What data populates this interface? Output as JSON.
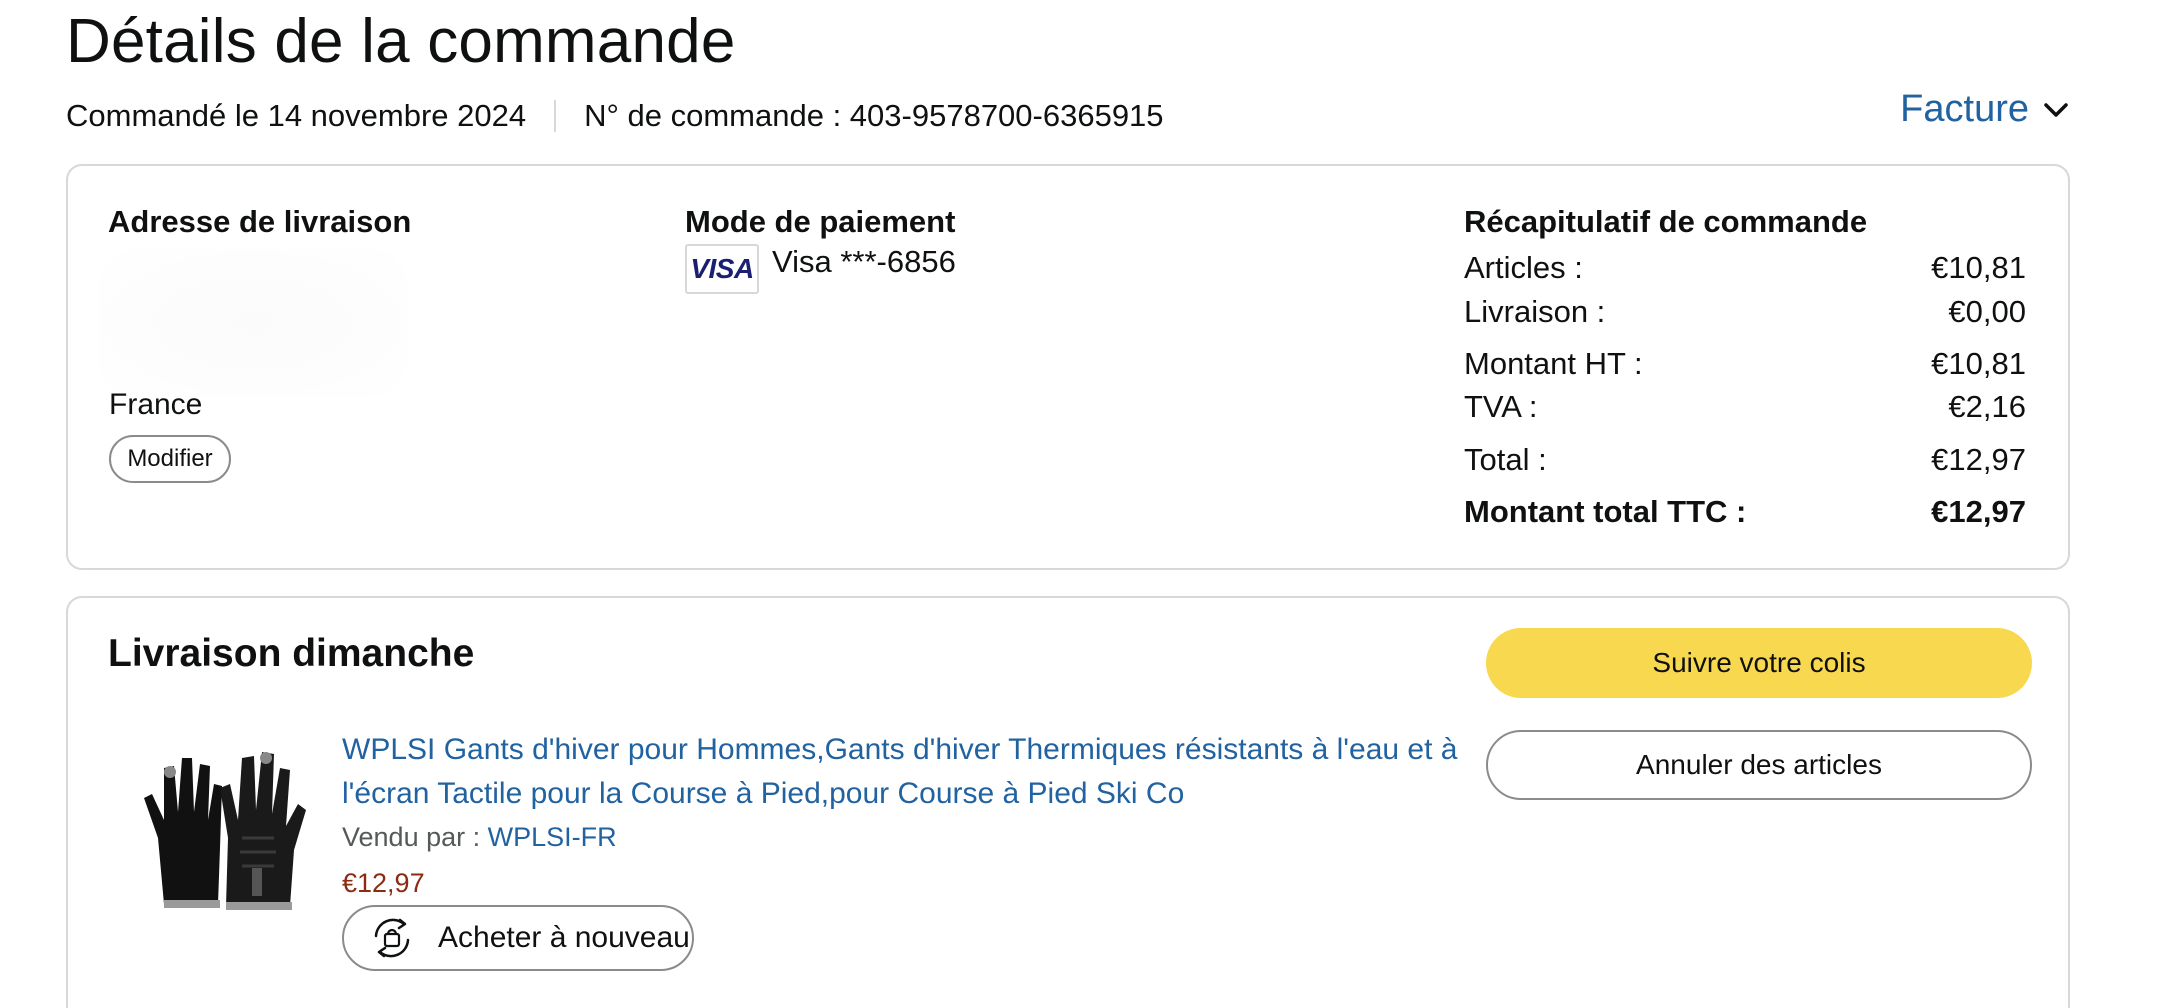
{
  "page": {
    "title": "Détails de la commande",
    "order_date": "Commandé le 14 novembre 2024",
    "order_number": "N° de commande : 403-9578700-6365915",
    "invoice_label": "Facture"
  },
  "summary_card": {
    "shipping_address": {
      "heading": "Adresse de livraison",
      "country": "France",
      "modify_label": "Modifier"
    },
    "payment": {
      "heading": "Mode de paiement",
      "card_brand": "VISA",
      "card_text": "Visa ***-6856"
    },
    "order_summary": {
      "heading": "Récapitulatif de commande",
      "rows": [
        {
          "label": "Articles :",
          "value": "€10,81"
        },
        {
          "label": "Livraison :",
          "value": "€0,00"
        },
        {
          "label": "Montant HT :",
          "value": "€10,81"
        },
        {
          "label": "TVA :",
          "value": "€2,16"
        },
        {
          "label": "Total :",
          "value": "€12,97"
        },
        {
          "label": "Montant total TTC :",
          "value": "€12,97"
        }
      ]
    }
  },
  "shipment": {
    "heading": "Livraison dimanche",
    "product": {
      "title": "WPLSI Gants d'hiver pour Hommes,Gants d'hiver Thermiques résistants à l'eau et à l'écran Tactile pour la Course à Pied,pour Course à Pied Ski Co",
      "sold_by_label": "Vendu par : ",
      "seller": "WPLSI-FR",
      "price": "€12,97",
      "buy_again_label": "Acheter à nouveau"
    },
    "actions": {
      "track_label": "Suivre votre colis",
      "cancel_label": "Annuler des articles"
    }
  },
  "colors": {
    "link": "#2162a1",
    "price": "#8b2b13",
    "track_button": "#f7d84e",
    "border": "#d5d9d9"
  },
  "icons": [
    "chevron-down-icon",
    "visa-logo",
    "buy-again-icon",
    "glove-product-image"
  ]
}
